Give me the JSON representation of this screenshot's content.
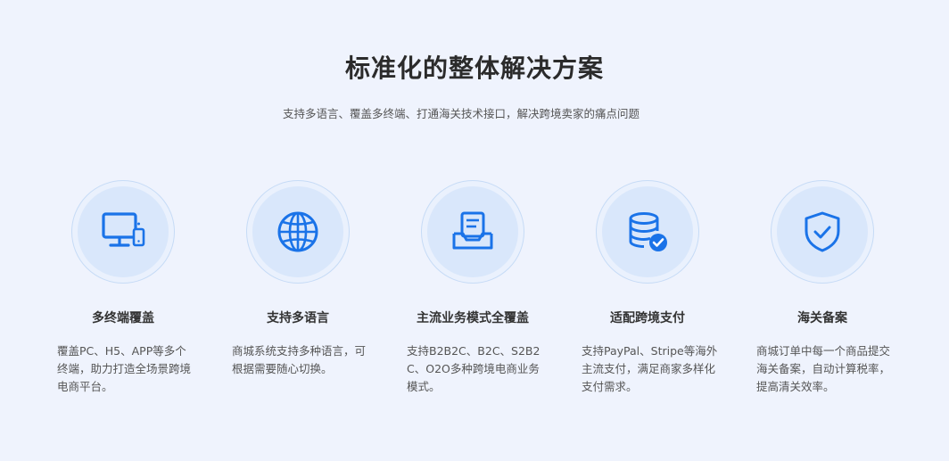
{
  "header": {
    "title": "标准化的整体解决方案",
    "subtitle": "支持多语言、覆盖多终端、打通海关技术接口，解决跨境卖家的痛点问题"
  },
  "features": [
    {
      "icon": "multi-device-icon",
      "title": "多终端覆盖",
      "desc": "覆盖PC、H5、APP等多个终端，助力打造全场景跨境电商平台。"
    },
    {
      "icon": "globe-icon",
      "title": "支持多语言",
      "desc": "商城系统支持多种语言，可根据需要随心切换。"
    },
    {
      "icon": "business-model-icon",
      "title": "主流业务模式全覆盖",
      "desc": "支持B2B2C、B2C、S2B2C、O2O多种跨境电商业务模式。"
    },
    {
      "icon": "payment-database-icon",
      "title": "适配跨境支付",
      "desc": "支持PayPal、Stripe等海外主流支付，满足商家多样化支付需求。"
    },
    {
      "icon": "shield-check-icon",
      "title": "海关备案",
      "desc": "商城订单中每一个商品提交海关备案，自动计算税率，提高清关效率。"
    }
  ],
  "colors": {
    "background": "#eff3fd",
    "icon_blue": "#1a73e8",
    "circle_fill": "#d9e7fb"
  }
}
